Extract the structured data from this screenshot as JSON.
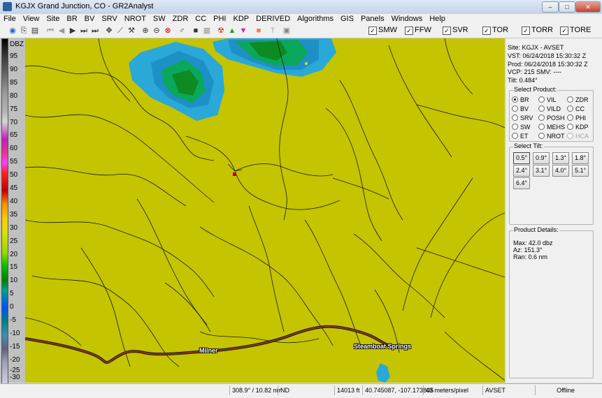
{
  "window": {
    "title": "KGJX Grand Junction, CO - GR2Analyst",
    "minimize": "–",
    "maximize": "□",
    "close": "✕"
  },
  "menu": [
    "File",
    "View",
    "Site",
    "BR",
    "BV",
    "SRV",
    "NROT",
    "SW",
    "ZDR",
    "CC",
    "PHI",
    "KDP",
    "DERIVED",
    "Algorithms",
    "GIS",
    "Panels",
    "Windows",
    "Help"
  ],
  "toolbar": {
    "icons": [
      "globe-icon",
      "copy-icon",
      "paste-icon",
      "first-frame-icon",
      "prev-frame-icon",
      "play-icon",
      "next-frame-icon",
      "last-frame-icon",
      "pan-icon",
      "measure-icon",
      "wrench-icon",
      "zoom-in-icon",
      "zoom-out-icon",
      "zoom-reset-icon",
      "probe-icon",
      "stop-icon",
      "layout-icon",
      "storm-icon",
      "triangle-up-icon",
      "triangle-down-icon",
      "color-icon",
      "text-icon",
      "frame-icon"
    ],
    "warnings": [
      {
        "label": "SMW",
        "checked": true
      },
      {
        "label": "FFW",
        "checked": true
      },
      {
        "label": "SVR",
        "checked": true
      },
      {
        "label": "TOR",
        "checked": true
      },
      {
        "label": "TORR",
        "checked": true
      },
      {
        "label": "TORE",
        "checked": true
      }
    ]
  },
  "colorbar": {
    "unit": "DBZ",
    "labels": [
      "95",
      "90",
      "85",
      "80",
      "75",
      "70",
      "65",
      "60",
      "55",
      "50",
      "45",
      "40",
      "35",
      "30",
      "25",
      "20",
      "15",
      "10",
      "5",
      "0",
      "-5",
      "-10",
      "-15",
      "-20",
      "-25",
      "-30"
    ]
  },
  "map": {
    "labels": [
      "Milner",
      "Steamboat Springs"
    ],
    "radar_echo_color_light": "#2aa8d8",
    "radar_echo_color_mid": "#0aa85a",
    "radar_echo_color_core": "#0e8a22",
    "background_color": "#c4c400",
    "highway_color": "#8a3a1a"
  },
  "site_info": {
    "site": "Site:   KGJX - AVSET",
    "vst": "VST:    06/24/2018  15:30:32 Z",
    "prod": "Prod:   06/24/2018  15:30:32 Z",
    "vcp": "VCP:    215           SMV: ----",
    "tilt": "Tilt:    0.484°"
  },
  "select_product": {
    "title": "Select Product:",
    "options": [
      {
        "label": "BR",
        "selected": true,
        "disabled": false
      },
      {
        "label": "VIL",
        "selected": false,
        "disabled": false
      },
      {
        "label": "ZDR",
        "selected": false,
        "disabled": false
      },
      {
        "label": "BV",
        "selected": false,
        "disabled": false
      },
      {
        "label": "VILD",
        "selected": false,
        "disabled": false
      },
      {
        "label": "CC",
        "selected": false,
        "disabled": false
      },
      {
        "label": "SRV",
        "selected": false,
        "disabled": false
      },
      {
        "label": "POSH",
        "selected": false,
        "disabled": false
      },
      {
        "label": "PHI",
        "selected": false,
        "disabled": false
      },
      {
        "label": "SW",
        "selected": false,
        "disabled": false
      },
      {
        "label": "MEHS",
        "selected": false,
        "disabled": false
      },
      {
        "label": "KDP",
        "selected": false,
        "disabled": false
      },
      {
        "label": "ET",
        "selected": false,
        "disabled": false
      },
      {
        "label": "NROT",
        "selected": false,
        "disabled": false
      },
      {
        "label": "HCA",
        "selected": false,
        "disabled": true
      }
    ]
  },
  "select_tilt": {
    "title": "Select Tilt:",
    "tilts": [
      "0.5°",
      "0.9°",
      "1.3°",
      "1.8°",
      "2.4°",
      "3.1°",
      "4.0°",
      "5.1°",
      "6.4°"
    ],
    "active": "0.5°"
  },
  "product_details": {
    "title": "Product Details:",
    "max": "Max:  42.0 dbz",
    "az": "Az:   151.3°",
    "ran": "Ran:  0.6 nm"
  },
  "status": {
    "azimuth_range": "308.9° / 10.82 nm",
    "value": "ND",
    "height": "14013 ft",
    "coords": "40.745087, -107.173805",
    "scale": "43 meters/pixel",
    "site": "AVSET",
    "connection": "Offline"
  }
}
